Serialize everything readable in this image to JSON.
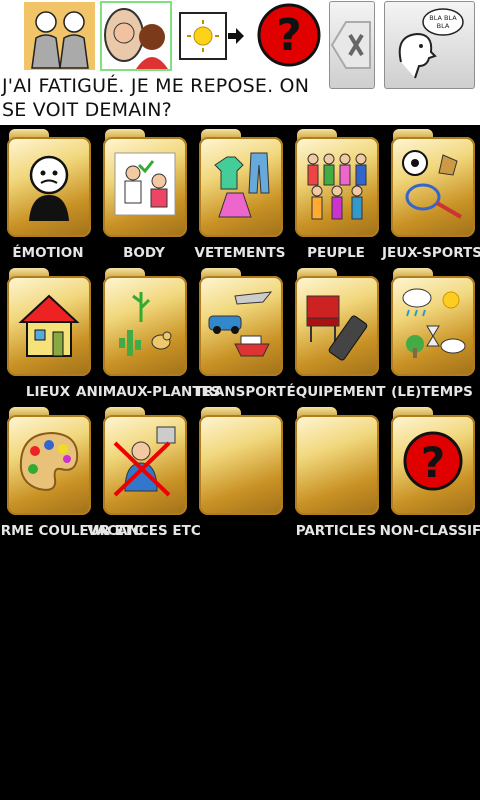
{
  "toolbar": {
    "icons": [
      "two-people-icon",
      "mirror-icon",
      "sun-arrow-icon",
      "question-icon",
      "backspace-icon",
      "speak-icon"
    ],
    "speak_text": "BLA BLA BLA"
  },
  "sentence": "J'AI FATIGUÉ. JE ME REPOSE. ON SE VOIT DEMAIN?",
  "categories": [
    {
      "label": "ÉMOTION",
      "icon": "emotion-icon"
    },
    {
      "label": "BODY",
      "icon": "body-icon"
    },
    {
      "label": "VETEMENTS",
      "icon": "clothes-icon"
    },
    {
      "label": "PEUPLE",
      "icon": "people-icon"
    },
    {
      "label": "JEUX-SPORTS",
      "icon": "sports-icon"
    },
    {
      "label": "LIEUX",
      "icon": "house-icon"
    },
    {
      "label": "ANIMAUX-PLANTES",
      "icon": "plant-icon"
    },
    {
      "label": "TRANSPORT",
      "icon": "transport-icon"
    },
    {
      "label": "ÉQUIPEMENT",
      "icon": "equipment-icon"
    },
    {
      "label": "(LE)TEMPS",
      "icon": "weather-icon"
    },
    {
      "label": "FORME COULEUR ETC",
      "icon": "palette-icon"
    },
    {
      "label": "VACANCES ETC",
      "icon": "vacation-icon"
    },
    {
      "label": "",
      "icon": ""
    },
    {
      "label": "PARTICLES",
      "icon": "particles-icon"
    },
    {
      "label": "NON-CLASSIF.",
      "icon": "question-icon"
    }
  ]
}
